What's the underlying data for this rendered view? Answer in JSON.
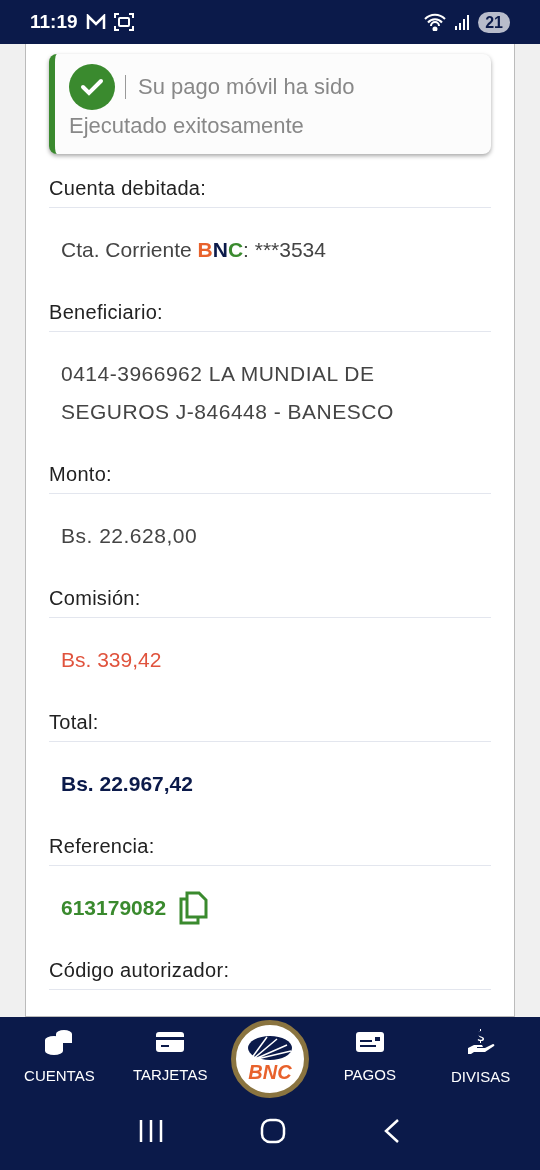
{
  "status_bar": {
    "time": "11:19",
    "battery": "21"
  },
  "toast": {
    "title": "Su pago móvil ha sido",
    "message": "Ejecutado exitosamente"
  },
  "fields": [
    {
      "label": "Cuenta debitada:",
      "kind": "account",
      "parts": [
        {
          "text": "Cta. Corriente ",
          "color": "#444444",
          "bold": false
        },
        {
          "text": "B",
          "color": "#e8622c",
          "bold": true
        },
        {
          "text": "N",
          "color": "#0b1a4a",
          "bold": true
        },
        {
          "text": "C",
          "color": "#3a8a2e",
          "bold": true
        },
        {
          "text": ": ***3534",
          "color": "#444444",
          "bold": false
        }
      ]
    },
    {
      "label": "Beneficiario:",
      "kind": "plain",
      "value": "0414-3966962 LA MUNDIAL DE SEGUROS J-846448 - BANESCO"
    },
    {
      "label": "Monto:",
      "kind": "plain",
      "value": "Bs. 22.628,00"
    },
    {
      "label": "Comisión:",
      "kind": "fee",
      "value": "Bs. 339,42"
    },
    {
      "label": "Total:",
      "kind": "total",
      "value": "Bs. 22.967,42"
    },
    {
      "label": "Referencia:",
      "kind": "reference",
      "value": "613179082"
    },
    {
      "label": "Código autorizador:",
      "kind": "cut"
    }
  ],
  "nav": [
    {
      "label": "CUENTAS",
      "kind": "coins"
    },
    {
      "label": "TARJETAS",
      "kind": "card"
    },
    {
      "label": "PAGOS",
      "kind": "ticket"
    },
    {
      "label": "DIVISAS",
      "kind": "dollar"
    }
  ],
  "logo": {
    "text": "BNC"
  }
}
